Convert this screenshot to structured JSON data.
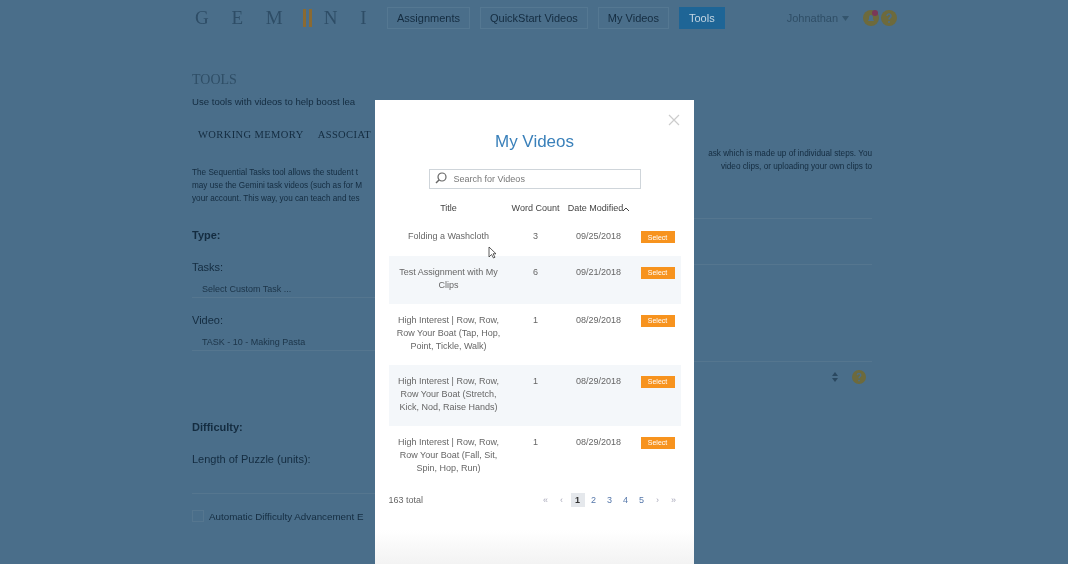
{
  "header": {
    "logo_left": "G E M",
    "logo_right": "N I",
    "nav": [
      {
        "label": "Assignments",
        "selected": false
      },
      {
        "label": "QuickStart Videos",
        "selected": false
      },
      {
        "label": "My Videos",
        "selected": false
      },
      {
        "label": "Tools",
        "selected": true
      }
    ],
    "user": "Johnathan"
  },
  "page": {
    "title": "TOOLS",
    "subtitle": "Use tools with videos to help boost lea",
    "tabs": [
      {
        "label": "WORKING MEMORY"
      },
      {
        "label": "ASSOCIAT"
      }
    ],
    "description_left": [
      "The Sequential Tasks tool allows the student t",
      "may use the Gemini task videos (such as for M",
      "your account. This way, you can teach and tes"
    ],
    "description_right": [
      "ask which is made up of individual steps. You",
      "video clips, or uploading your own clips to"
    ],
    "type_label": "Type:",
    "tasks_label": "Tasks:",
    "tasks_placeholder": "Select Custom Task ...",
    "video_label": "Video:",
    "video_value": "TASK - 10 - Making Pasta",
    "difficulty_label": "Difficulty:",
    "length_label": "Length of Puzzle (units):",
    "auto_advance": {
      "label": "Automatic Difficulty Advancement E",
      "checked": false
    }
  },
  "modal": {
    "title": "My Videos",
    "search": {
      "placeholder": "Search for Videos"
    },
    "columns": [
      "Title",
      "Word Count",
      "Date Modified"
    ],
    "rows": [
      {
        "title": "Folding a Washcloth",
        "word_count": "3",
        "date": "09/25/2018",
        "action": "Select"
      },
      {
        "title": "Test Assignment with My Clips",
        "word_count": "6",
        "date": "09/21/2018",
        "action": "Select"
      },
      {
        "title": "High Interest | Row, Row, Row Your Boat (Tap, Hop, Point, Tickle, Walk)",
        "word_count": "1",
        "date": "08/29/2018",
        "action": "Select"
      },
      {
        "title": "High Interest | Row, Row, Row Your Boat (Stretch, Kick, Nod, Raise Hands)",
        "word_count": "1",
        "date": "08/29/2018",
        "action": "Select"
      },
      {
        "title": "High Interest | Row, Row, Row Your Boat (Fall, Sit, Spin, Hop, Run)",
        "word_count": "1",
        "date": "08/29/2018",
        "action": "Select"
      }
    ],
    "total": "163 total",
    "pagination": [
      {
        "label": "«",
        "selected": false
      },
      {
        "label": "‹",
        "selected": false
      },
      {
        "label": "1",
        "selected": true
      },
      {
        "label": "2",
        "selected": false
      },
      {
        "label": "3",
        "selected": false
      },
      {
        "label": "4",
        "selected": false
      },
      {
        "label": "5",
        "selected": false
      },
      {
        "label": "›",
        "selected": false
      },
      {
        "label": "»",
        "selected": false
      }
    ]
  }
}
